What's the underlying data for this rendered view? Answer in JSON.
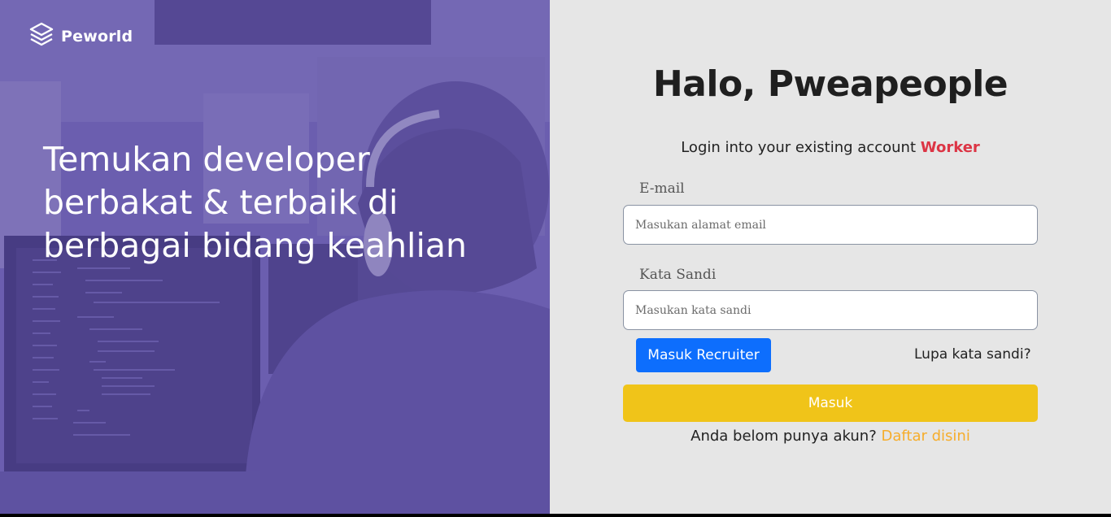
{
  "brand": {
    "name": "Peworld",
    "icon": "layers-icon"
  },
  "hero": {
    "headline": "Temukan developer\nberbakat & terbaik di\nberbagai bidang keahlian"
  },
  "login": {
    "title": "Halo, Pweapeople",
    "subtitle_prefix": "Login into your existing account",
    "role": "Worker",
    "email": {
      "label": "E-mail",
      "placeholder": "Masukan alamat email",
      "value": ""
    },
    "password": {
      "label": "Kata Sandi",
      "placeholder": "Masukan kata sandi",
      "value": ""
    },
    "recruiter_button": "Masuk Recruiter",
    "forgot_link": "Lupa kata sandi?",
    "submit_button": "Masuk",
    "signup_prefix": "Anda belom punya akun?",
    "signup_link": "Daftar disini"
  },
  "colors": {
    "hero_overlay": "#5e50a1",
    "panel_bg": "#e6e6e6",
    "role_text": "#dc3545",
    "recruiter_button": "#0d6efd",
    "submit_button": "#f0c419",
    "signup_link": "#f6ad2b"
  }
}
